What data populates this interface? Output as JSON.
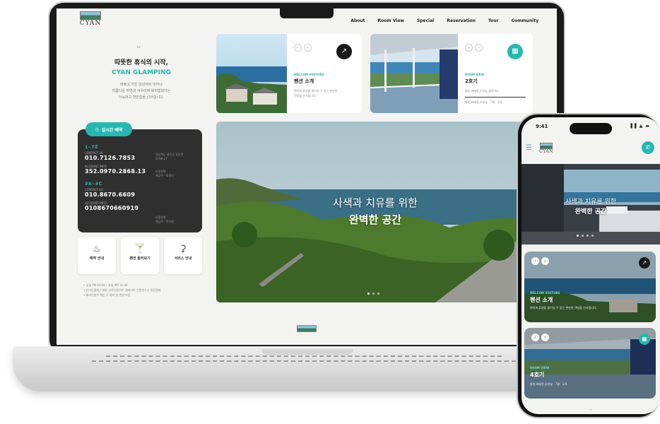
{
  "site": {
    "logo_text": "CYAN",
    "nav": [
      "About",
      "Room View",
      "Special",
      "Reservation",
      "Tour",
      "Community"
    ]
  },
  "intro": {
    "quote": "“",
    "title_line1": "따뜻한 휴식의 시작,",
    "title_line2": "CYAN GLAMPING",
    "desc_line1": "바쁘고 지친 일상에서 벗어나",
    "desc_line2": "아름다운 자연과 어우러져 화려함보다는",
    "desc_line3": "아늑하고 편안함을 선사합니다."
  },
  "contact": {
    "button_label": "실시간 예약",
    "group1": {
      "room": "1~7호",
      "contact_label": "CONTACT US",
      "phone": "010.7126.7853",
      "account_label": "ACCOUNT INFO",
      "account": "352.0970.2868.13",
      "side_top_line1": "경상북도 울진군 동산면",
      "side_top_line2": "2198-27",
      "side_bottom_line1": "농협은행",
      "side_bottom_line2": "예금주 : 최용탁"
    },
    "group2": {
      "room": "#A~#C",
      "contact_label": "CONTACT US",
      "phone": "010.8670.6609",
      "account_label": "ACCOUNT INFO",
      "account": "0108670660919",
      "side_bottom_line1": "농협은행",
      "side_bottom_line2": "예금주 : 전석원"
    }
  },
  "services": [
    {
      "icon": "bell-icon",
      "label": "예약 안내"
    },
    {
      "icon": "cocktail-icon",
      "label": "펜션 둘러보기"
    },
    {
      "icon": "service-bell-icon",
      "label": "서비스 안내"
    }
  ],
  "notes": [
    "입실 PM 03:00 / 퇴실 AM 11:00",
    "온라인결제시 예실 기준인원으로 결제되며 인원추가시 현장결제",
    "최대인원수 확인 후 예약 및 변경 바람"
  ],
  "cards": [
    {
      "eyebrow": "WELCOM VISITORS",
      "title": "펜션 소개",
      "desc_line1": "편하게 휴양을 즐기실 수 있는 편안한",
      "desc_line2": "객실을 선사합니다.",
      "button_icon": "arrow-up-right-icon",
      "button_color": "#1a1a1a"
    },
    {
      "eyebrow": "ROOM VIEW",
      "title": "2호기",
      "desc_line1": "통창,바베큐,오션뷰,불멍가능",
      "desc_line2": "통창,바베큐,오션뷰 · 7평 · 2/4",
      "button_icon": "calendar-icon",
      "button_color": "#27b7b0"
    }
  ],
  "hero": {
    "line1": "사색과 치유를 위한",
    "line2": "완벽한 공간"
  },
  "phone": {
    "time": "9:41",
    "status": "▐▐ ▲ ▬",
    "hero_line1": "사색과 치유를 위한",
    "hero_line2": "완벽한 공간",
    "cards": [
      {
        "eyebrow": "WELCOM VISITORS",
        "title": "펜션 소개",
        "desc": "편하게 휴양을 즐기실 수 있는 편안한 객실을 선사합니다."
      },
      {
        "eyebrow": "ROOM VIEW",
        "title": "4호기",
        "desc": "통창,바베큐,오션뷰 · 7평 · 2/4"
      }
    ],
    "quote": "“"
  },
  "colors": {
    "accent": "#27b7b0",
    "dark_panel": "#2f2f2f"
  }
}
